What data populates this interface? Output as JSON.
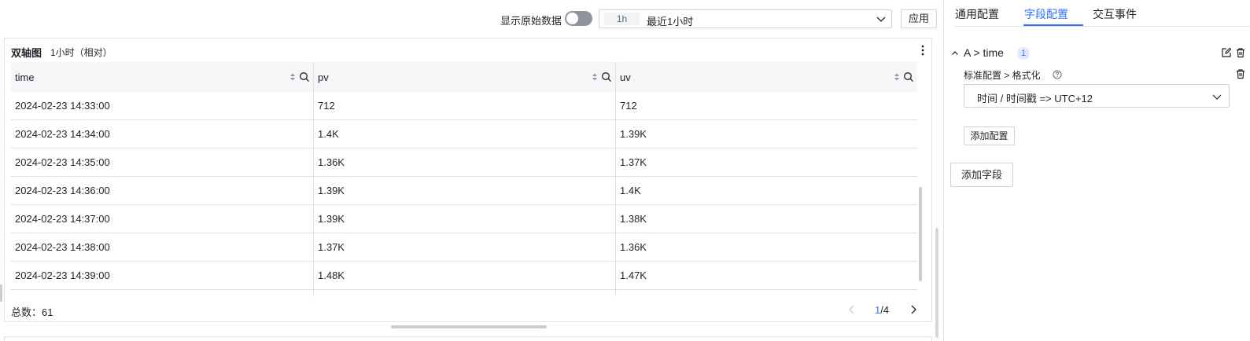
{
  "toolbar": {
    "raw_data_label": "显示原始数据",
    "raw_data_toggle_on": false,
    "time_range_chip": "1h",
    "time_range_label": "最近1小时",
    "apply_label": "应用"
  },
  "panel": {
    "title": "双轴图",
    "subtitle": "1小时（相对）",
    "more_icon": "more-vertical-icon"
  },
  "table": {
    "columns": [
      "time",
      "pv",
      "uv"
    ],
    "rows": [
      [
        "2024-02-23 14:33:00",
        "712",
        "712"
      ],
      [
        "2024-02-23 14:34:00",
        "1.4K",
        "1.39K"
      ],
      [
        "2024-02-23 14:35:00",
        "1.36K",
        "1.37K"
      ],
      [
        "2024-02-23 14:36:00",
        "1.39K",
        "1.4K"
      ],
      [
        "2024-02-23 14:37:00",
        "1.39K",
        "1.38K"
      ],
      [
        "2024-02-23 14:38:00",
        "1.37K",
        "1.36K"
      ],
      [
        "2024-02-23 14:39:00",
        "1.48K",
        "1.47K"
      ],
      [
        "",
        "",
        ""
      ]
    ]
  },
  "footer": {
    "total_label": "总数：61",
    "page_current": "1",
    "page_total": "/4"
  },
  "sidebar": {
    "tabs": [
      {
        "label": "通用配置",
        "active": false
      },
      {
        "label": "字段配置",
        "active": true
      },
      {
        "label": "交互事件",
        "active": false
      }
    ],
    "field": {
      "title": "A > time",
      "badge": "1",
      "config_path": "标准配置 > 格式化",
      "format_value": "时间 / 时间戳 => UTC+12",
      "add_config_label": "添加配置"
    },
    "add_field_label": "添加字段"
  },
  "colors": {
    "accent": "#3370ff",
    "border": "#dee0e3",
    "header_bg": "#f5f6f7",
    "text": "#1f2329"
  }
}
